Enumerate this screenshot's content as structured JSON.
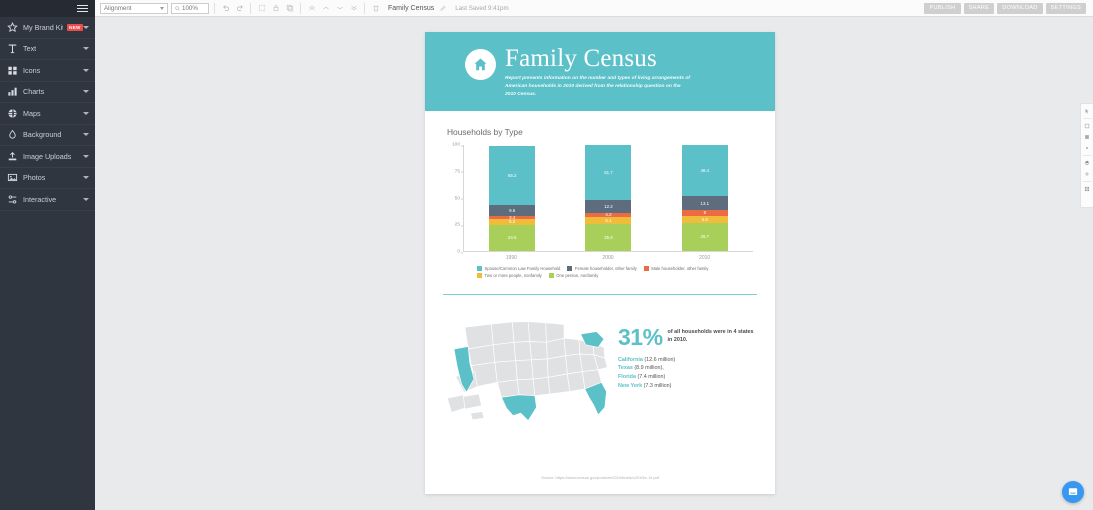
{
  "sidebar": {
    "menu_icon": "hamburger-icon",
    "items": [
      {
        "label": "My Brand Kit",
        "icon": "star-icon",
        "badge": "NEW"
      },
      {
        "label": "Text",
        "icon": "text-icon",
        "badge": ""
      },
      {
        "label": "Icons",
        "icon": "icons-grid-icon",
        "badge": ""
      },
      {
        "label": "Charts",
        "icon": "bar-chart-icon",
        "badge": ""
      },
      {
        "label": "Maps",
        "icon": "globe-icon",
        "badge": ""
      },
      {
        "label": "Background",
        "icon": "droplet-icon",
        "badge": ""
      },
      {
        "label": "Image Uploads",
        "icon": "upload-icon",
        "badge": ""
      },
      {
        "label": "Photos",
        "icon": "photo-icon",
        "badge": ""
      },
      {
        "label": "Interactive",
        "icon": "interactive-icon",
        "badge": ""
      }
    ]
  },
  "toolbar": {
    "alignment_label": "Alignment",
    "zoom_label": "100%",
    "doc_title": "Family Census",
    "last_saved": "Last Saved 9:41pm",
    "icons": [
      "undo-icon",
      "redo-icon",
      "duplicate-icon",
      "lock-icon",
      "copy-icon",
      "bring-to-front-icon",
      "bring-forward-icon",
      "send-backward-icon",
      "send-to-back-icon",
      "delete-icon",
      "rename-icon"
    ],
    "publish_label": "PUBLISH",
    "share_label": "SHARE",
    "download_label": "DOWNLOAD",
    "settings_label": "SETTINGS"
  },
  "infographic": {
    "title": "Family Census",
    "subtitle": "Report presents information on the number and types of living arrangements of American households in 2010 derived from the relationship question on the 2010 Census.",
    "header_icon": "home-icon",
    "stat_number": "31%",
    "stat_caption": "of all households were in 4 states in 2010.",
    "states": [
      {
        "name": "California",
        "value": "(12.6 million)"
      },
      {
        "name": "Texas",
        "value": "(8.9 million),"
      },
      {
        "name": "Florida",
        "value": "(7.4 million)"
      },
      {
        "name": "New York",
        "value": "(7.3 million)"
      }
    ],
    "source": "Source: https://www.census.gov/prod/cen2010/briefs/c2010br-14.pdf",
    "accent_color": "#5bc0c8"
  },
  "chart_data": {
    "type": "bar",
    "stacked": true,
    "title": "Households by Type",
    "xlabel": "",
    "ylabel": "",
    "ylim": [
      0,
      100
    ],
    "yticks": [
      0,
      25,
      50,
      75,
      100
    ],
    "grid": false,
    "legend_position": "bottom",
    "categories": [
      "1990",
      "2000",
      "2010"
    ],
    "series": [
      {
        "name": "One person, nonfamily",
        "color": "#a8cf5a",
        "values": [
          24.6,
          25.8,
          26.7
        ]
      },
      {
        "name": "Two or more people, nonfamily",
        "color": "#f0bc3a",
        "values": [
          5.2,
          6.1,
          6.8
        ]
      },
      {
        "name": "Male householder, other family",
        "color": "#ec6b45",
        "values": [
          3.4,
          4.2,
          5
        ]
      },
      {
        "name": "Female householder, other family",
        "color": "#5d6d7e",
        "values": [
          9.6,
          12.2,
          13.1
        ]
      },
      {
        "name": "Spouse/Common Law Family Household",
        "color": "#5bc0c8",
        "values": [
          55.2,
          51.7,
          48.4
        ]
      }
    ],
    "legend_order": [
      "Spouse/Common Law Family Household",
      "Female householder, other family",
      "Male householder, other family",
      "Two or more people, nonfamily",
      "One person, nonfamily"
    ]
  },
  "map": {
    "highlight_color": "#5bc0c8",
    "base_color": "#e0e1e3",
    "highlighted_states": [
      "California",
      "Texas",
      "Florida",
      "New York"
    ]
  },
  "chat": {
    "icon": "chat-icon"
  }
}
